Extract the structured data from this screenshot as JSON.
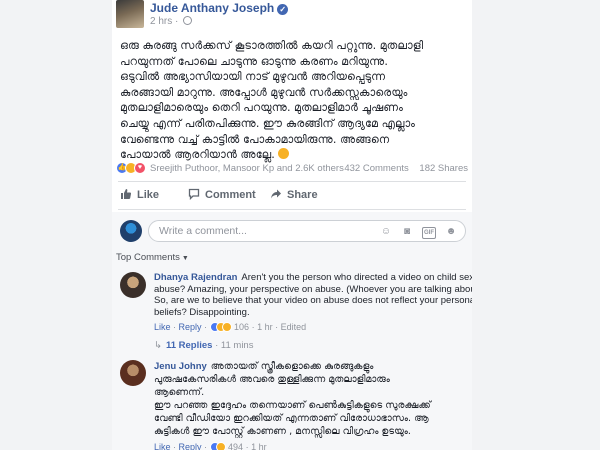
{
  "post": {
    "author": "Jude Anthany Joseph",
    "verified_icon": "verified-badge-icon",
    "time": "2 hrs",
    "privacy_icon": "globe-icon",
    "body_lines": [
      "ഒരു കുരങ്ങു സർക്കസ് കൂടാരത്തിൽ കയറി പറ്റുന്നു. മുതലാളി",
      "പറയുന്നത് പോലെ ചാടുന്നു ഓടുന്നു കരണം മറിയുന്നു.",
      "ഒടുവിൽ അഭ്യാസിയായി നാട് മുഴുവൻ അറിയപ്പെടുന്ന",
      "കുരങ്ങായി മാറുന്നു. അപ്പോൾ മുഴുവൻ സർക്കസ്സുകാരെയും",
      "മുതലാളിമാരെയും തെറി പറയുന്നു. മുതലാളിമാർ ചൂഷണം",
      "ചെയ്യു എന്ന് പരിതപിക്കുന്നു. ഈ കുരങ്ങിന് ആദ്യമേ എല്ലാം",
      "വേണ്ടെന്നു വച്ച് കാട്ടിൽ പോകാമായിരുന്നു. അങ്ങനെ",
      "പോയാൽ ആരറിയാൻ അല്ലേ."
    ],
    "body_end_emoji": "laughing-emoji-icon"
  },
  "summary": {
    "reactions_text": "Sreejith Puthoor, Mansoor Kp and 2.6K others",
    "comments_count": "432 Comments",
    "shares_count": "182 Shares"
  },
  "actions": {
    "like": "Like",
    "comment": "Comment",
    "share": "Share"
  },
  "composer": {
    "placeholder": "Write a comment..."
  },
  "sort": {
    "label": "Top Comments"
  },
  "comments": [
    {
      "name": "Dhanya Rajendran",
      "lines": [
        "Aren't you the person who directed a video on child sexual",
        "abuse? Amazing, your perspective on abuse. (Whoever you are talking about).",
        "So, are we to believe that your video on abuse does not reflect your personal",
        "beliefs? Disappointing."
      ],
      "like": "Like",
      "reply": "Reply",
      "reaction_count": "106",
      "time": "1 hr",
      "edited": "Edited",
      "replies": "11 Replies",
      "replies_time": "11 mins"
    },
    {
      "name": "Jenu Johny",
      "lines": [
        "അതായത് സ്ത്രീകളൊക്കെ കുരങ്ങുകളും",
        "പുരുഷകേസരികൾ അവരെ തുള്ളിക്കുന്ന മുതലാളിമാരും",
        "ആണെന്ന്.",
        "ഈ പറഞ്ഞ ഇദ്ദേഹം തന്നെയാണ് പെൺകുട്ടികളുടെ സുരക്ഷക്ക്",
        "വേണ്ടി വീഡിയോ ഇറക്കിയത് എന്നതാണ് വിരോധാഭാസം. ആ",
        "കുട്ടികൾ ഈ പോസ്റ്റ് കാണണ , മനസ്സിലെ വിഗ്രഹം ഉടയും."
      ],
      "like": "Like",
      "reply": "Reply",
      "reaction_count": "494",
      "time": "1 hr"
    }
  ],
  "colors": {
    "link_blue": "#365899",
    "meta_gray": "#90949c",
    "like_blue": "#4a79f2",
    "haha_yellow": "#f7b125",
    "love_red": "#f25268"
  }
}
